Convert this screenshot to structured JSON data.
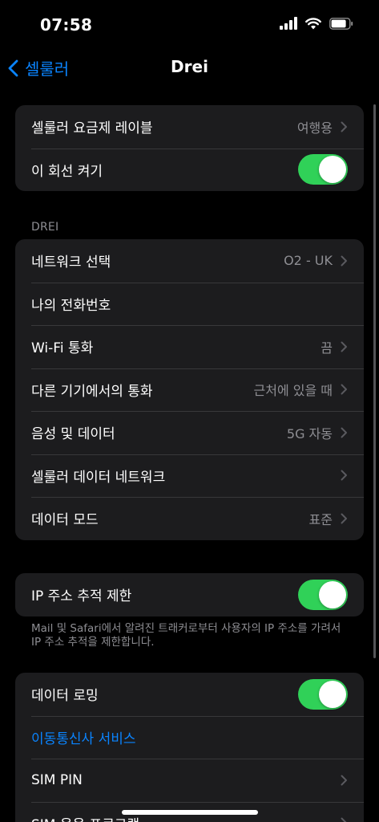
{
  "status": {
    "time": "07:58"
  },
  "nav": {
    "back_label": "셀룰러",
    "title": "Drei"
  },
  "group1": {
    "plan_label": "셀룰러 요금제 레이블",
    "plan_value": "여행용",
    "line_toggle_label": "이 회선 켜기",
    "line_toggle_on": true
  },
  "section_drei": {
    "header": "DREI"
  },
  "drei": {
    "network_selection_label": "네트워크 선택",
    "network_selection_value": "O2 - UK",
    "my_number_label": "나의 전화번호",
    "wifi_calling_label": "Wi-Fi 통화",
    "wifi_calling_value": "끔",
    "other_devices_label": "다른 기기에서의 통화",
    "other_devices_value": "근처에 있을 때",
    "voice_data_label": "음성 및 데이터",
    "voice_data_value": "5G 자동",
    "cellular_network_label": "셀룰러 데이터 네트워크",
    "data_mode_label": "데이터 모드",
    "data_mode_value": "표준"
  },
  "ip_tracking": {
    "label": "IP 주소 추적 제한",
    "on": true,
    "footer": "Mail 및 Safari에서 알려진 트래커로부터 사용자의 IP 주소를 가려서 IP 주소 추적을 제한합니다."
  },
  "roaming": {
    "data_roaming_label": "데이터 로밍",
    "data_roaming_on": true,
    "carrier_services_label": "이동통신사 서비스",
    "sim_pin_label": "SIM PIN",
    "sim_apps_label": "SIM 응용 프로그램"
  },
  "colors": {
    "accent": "#0a84ff",
    "toggle_on": "#30d158",
    "cell_bg": "#1c1c1e",
    "background": "#000000",
    "secondary_text": "#8e8e93"
  }
}
